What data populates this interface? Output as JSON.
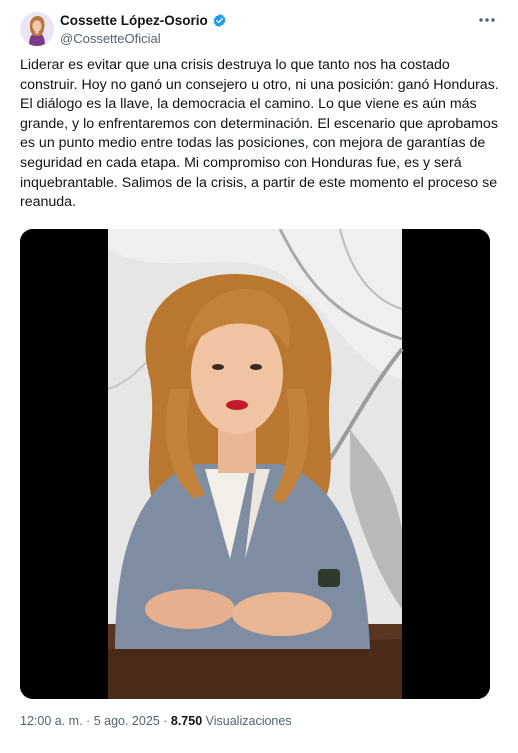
{
  "author": {
    "display_name": "Cossette López-Osorio",
    "handle": "@CossetteOficial",
    "verified": true
  },
  "tweet": {
    "text": "Liderar es evitar que una crisis destruya lo que tanto nos ha costado construir. Hoy no ganó un consejero u otro, ni una posición: ganó Honduras. El diálogo es la llave, la democracia el camino. Lo que viene es aún más grande, y lo enfrentaremos con determinación. El escenario que aprobamos es un punto medio entre todas las posiciones, con mejora de garantías de seguridad en cada etapa. Mi compromiso con Honduras fue, es y será inquebrantable. Salimos de la crisis, a partir de este momento el proceso se reanuda."
  },
  "meta": {
    "time": "12:00 a. m.",
    "separator": "·",
    "date": "5 ago. 2025",
    "views_count": "8.750",
    "views_label": "Visualizaciones"
  },
  "icons": {
    "more": "more-horizontal-icon",
    "verified": "verified-badge-icon"
  },
  "colors": {
    "verified_blue": "#1d9bf0",
    "secondary_text": "#536471",
    "primary_text": "#0f1419"
  }
}
